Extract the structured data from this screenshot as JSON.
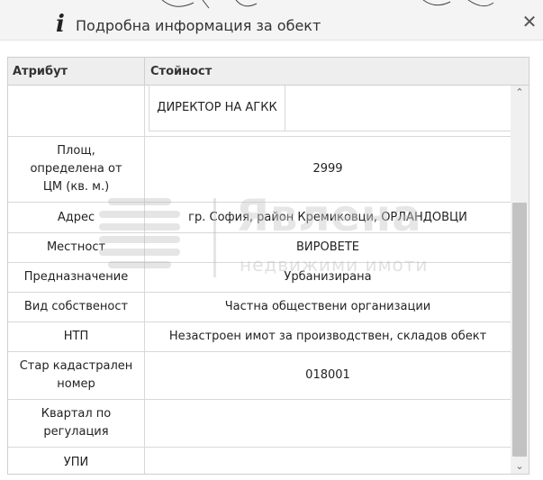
{
  "dialog": {
    "title": "Подробна информация за обект",
    "close_symbol": "✕",
    "info_icon_glyph": "i"
  },
  "table": {
    "headers": {
      "attribute": "Атрибут",
      "value": "Стойност"
    },
    "owner_cell": "ДИРЕКТОР НА АГКК",
    "rows": [
      {
        "attribute": "Площ, определена от ЦМ (кв. м.)",
        "value": "2999"
      },
      {
        "attribute": "Адрес",
        "value": "гр. София, район Кремиковци, ОРЛАНДОВЦИ"
      },
      {
        "attribute": "Местност",
        "value": "ВИРОВЕТЕ"
      },
      {
        "attribute": "Предназначение",
        "value": "Урбанизирана"
      },
      {
        "attribute": "Вид собственост",
        "value": "Частна обществени организации"
      },
      {
        "attribute": "НТП",
        "value": "Незастроен имот за производствен, складов обект"
      },
      {
        "attribute": "Стар кадастрален номер",
        "value": "018001"
      },
      {
        "attribute": "Квартал по регулация",
        "value": ""
      },
      {
        "attribute": "УПИ",
        "value": ""
      }
    ]
  },
  "scrollbar": {
    "up_glyph": "⌃",
    "down_glyph": "⌄"
  },
  "watermark": {
    "brand": "Явлена",
    "subtitle": "недвижими имоти"
  }
}
